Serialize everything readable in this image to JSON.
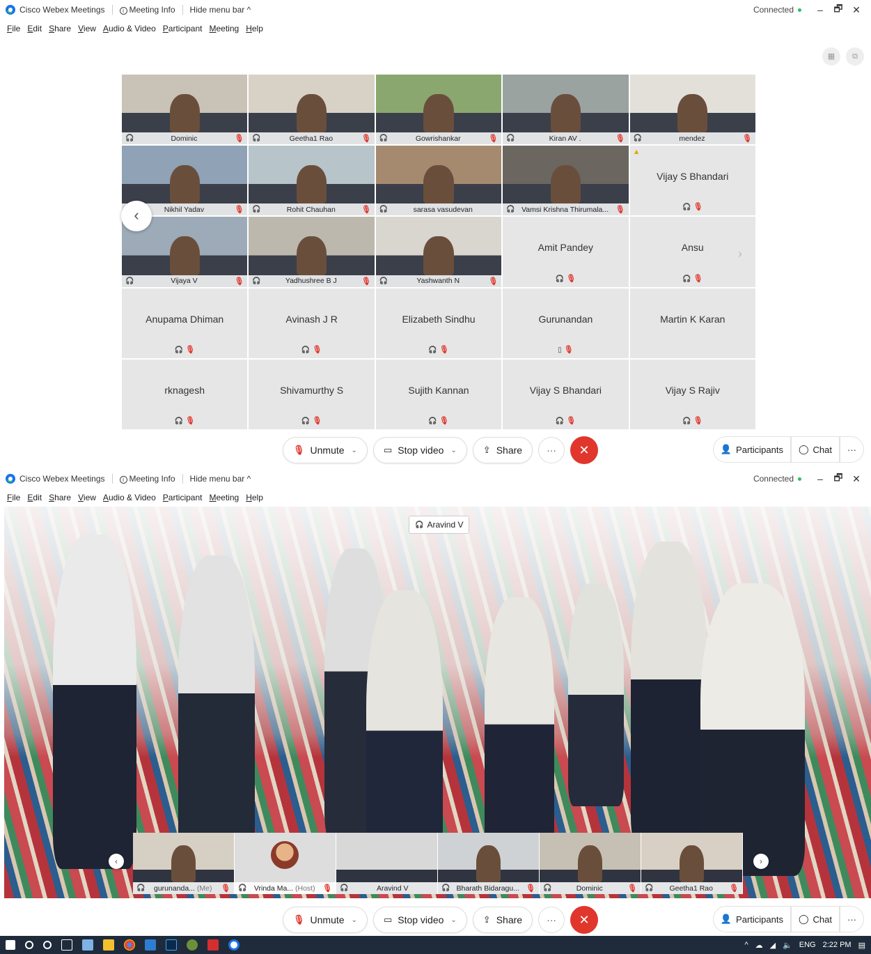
{
  "app": {
    "name": "Cisco Webex Meetings",
    "meeting_info": "Meeting Info",
    "hide_menu": "Hide menu bar ^",
    "status": "Connected",
    "window_controls": {
      "minimize": "–",
      "restore": "🗗",
      "close": "✕"
    }
  },
  "menu": [
    "File",
    "Edit",
    "Share",
    "View",
    "Audio & Video",
    "Participant",
    "Meeting",
    "Help"
  ],
  "grid": {
    "video_tiles": [
      {
        "name": "Dominic",
        "muted": true,
        "bg": "#c9c2b6"
      },
      {
        "name": "Geetha1 Rao",
        "muted": true,
        "bg": "#d8d1c6"
      },
      {
        "name": "Gowrishankar",
        "muted": true,
        "bg": "#8aa76f"
      },
      {
        "name": "Kiran AV .",
        "muted": true,
        "bg": "#9aa3a0"
      },
      {
        "name": "mendez",
        "muted": true,
        "bg": "#e3e0da"
      },
      {
        "name": "Nikhil Yadav",
        "muted": true,
        "bg": "#8fa2b6"
      },
      {
        "name": "Rohit Chauhan",
        "muted": true,
        "bg": "#b7c4c9"
      },
      {
        "name": "sarasa vasudevan",
        "muted": false,
        "bg": "#a58a70"
      },
      {
        "name": "Vamsi Krishna Thirumala...",
        "muted": true,
        "bg": "#6b6660"
      },
      {
        "name": "Vijaya V",
        "muted": true,
        "bg": "#9cabb7"
      },
      {
        "name": "Yadhushree B J",
        "muted": true,
        "bg": "#bdb8ae"
      },
      {
        "name": "Yashwanth N",
        "muted": true,
        "bg": "#d9d6cf"
      }
    ],
    "audio_tiles": [
      {
        "name": "Vijay S Bhandari",
        "warn": true
      },
      {
        "name": "Amit Pandey"
      },
      {
        "name": "Ansu"
      },
      {
        "name": "Anupama Dhiman"
      },
      {
        "name": "Avinash J R"
      },
      {
        "name": "Elizabeth Sindhu"
      },
      {
        "name": "Gurunandan",
        "phone": true
      },
      {
        "name": "Martin K Karan",
        "no_icons": true
      },
      {
        "name": "rknagesh"
      },
      {
        "name": "Shivamurthy S"
      },
      {
        "name": "Sujith Kannan"
      },
      {
        "name": "Vijay S Bhandari"
      },
      {
        "name": "Vijay S Rajiv"
      }
    ]
  },
  "controls": {
    "unmute": "Unmute",
    "stop_video": "Stop video",
    "share": "Share",
    "more": "···",
    "participants": "Participants",
    "chat": "Chat"
  },
  "stage": {
    "active_speaker": "Aravind V",
    "thumbnails": [
      {
        "name": "gurunanda...",
        "suffix": "(Me)",
        "bg": "#d6cfc3"
      },
      {
        "name": "Vrinda Ma...",
        "suffix": "(Host)",
        "bg": "#e6e6e6",
        "avatar": true
      },
      {
        "name": "Aravind V",
        "suffix": "",
        "bg": "#d8d8d8"
      },
      {
        "name": "Bharath Bidaragu...",
        "suffix": "",
        "bg": "#cfd2d4"
      },
      {
        "name": "Dominic",
        "suffix": "",
        "bg": "#c6c0b4"
      },
      {
        "name": "Geetha1 Rao",
        "suffix": "",
        "bg": "#d8d0c4"
      }
    ]
  },
  "taskbar": {
    "lang": "ENG",
    "time": "2:22 PM"
  }
}
